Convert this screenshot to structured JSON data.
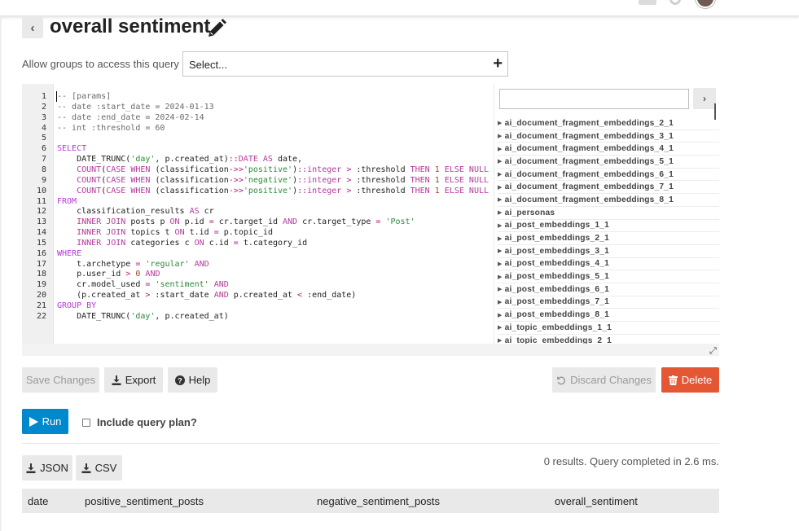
{
  "title": "overall sentiment",
  "groups": {
    "label": "Allow groups to access this query",
    "placeholder": "Select..."
  },
  "editor": {
    "lines": [
      "-- [params]",
      "-- date :start_date = 2024-01-13",
      "-- date :end_date = 2024-02-14",
      "-- int :threshold = 60",
      "",
      "SELECT",
      "    DATE_TRUNC('day', p.created_at)::DATE AS date,",
      "    COUNT(CASE WHEN (classification->>'positive')::integer > :threshold THEN 1 ELSE NULL END) AS positive_sentiment_posts,",
      "    COUNT(CASE WHEN (classification->>'negative')::integer > :threshold THEN 1 ELSE NULL END) AS negative_sentiment_posts,",
      "    COUNT(CASE WHEN (classification->>'positive')::integer > :threshold THEN 1 ELSE NULL END) AS overall_sentiment",
      "FROM",
      "    classification_results AS cr",
      "    INNER JOIN posts p ON p.id = cr.target_id AND cr.target_type = 'Post'",
      "    INNER JOIN topics t ON t.id = p.topic_id",
      "    INNER JOIN categories c ON c.id = t.category_id",
      "WHERE",
      "    t.archetype = 'regular' AND",
      "    p.user_id > 0 AND",
      "    cr.model_used = 'sentiment' AND",
      "    (p.created_at > :start_date AND p.created_at < :end_date)",
      "GROUP BY",
      "    DATE_TRUNC('day', p.created_at)"
    ]
  },
  "schema": {
    "filter_value": "",
    "tables": [
      "ai_document_fragment_embeddings_2_1",
      "ai_document_fragment_embeddings_3_1",
      "ai_document_fragment_embeddings_4_1",
      "ai_document_fragment_embeddings_5_1",
      "ai_document_fragment_embeddings_6_1",
      "ai_document_fragment_embeddings_7_1",
      "ai_document_fragment_embeddings_8_1",
      "ai_personas",
      "ai_post_embeddings_1_1",
      "ai_post_embeddings_2_1",
      "ai_post_embeddings_3_1",
      "ai_post_embeddings_4_1",
      "ai_post_embeddings_5_1",
      "ai_post_embeddings_6_1",
      "ai_post_embeddings_7_1",
      "ai_post_embeddings_8_1",
      "ai_topic_embeddings_1_1",
      "ai_topic_embeddings_2_1"
    ]
  },
  "buttons": {
    "save": "Save Changes",
    "export": "Export",
    "help": "Help",
    "discard": "Discard Changes",
    "delete": "Delete",
    "run": "Run",
    "json": "JSON",
    "csv": "CSV"
  },
  "include_plan_label": "Include query plan?",
  "results": {
    "status": "0 results. Query completed in 2.6 ms.",
    "columns": [
      "date",
      "positive_sentiment_posts",
      "negative_sentiment_posts",
      "overall_sentiment"
    ]
  },
  "colors": {
    "primary": "#0088cc",
    "danger": "#e45735",
    "button_bg": "#e9e9e9"
  }
}
